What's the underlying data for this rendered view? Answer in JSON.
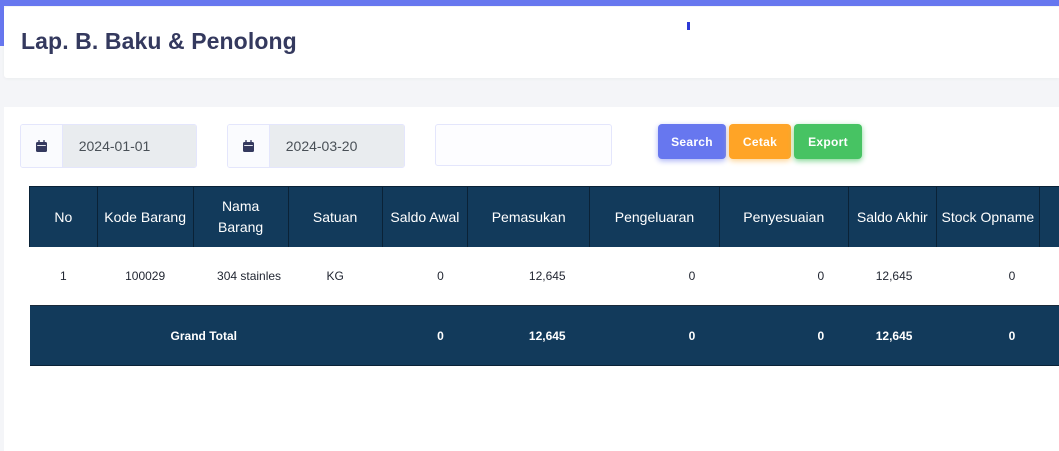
{
  "header": {
    "title": "Lap. B. Baku & Penolong"
  },
  "filters": {
    "start_date": "2024-01-01",
    "end_date": "2024-03-20",
    "search_text": "",
    "calendar_icon": "calendar-icon"
  },
  "buttons": {
    "search": "Search",
    "print": "Cetak",
    "export": "Export"
  },
  "colors": {
    "accent": "#6777ef",
    "print": "#ffa426",
    "export": "#47c363",
    "table_header": "#123a5b"
  },
  "table": {
    "columns": [
      "No",
      "Kode Barang",
      "Nama Barang",
      "Satuan",
      "Saldo Awal",
      "Pemasukan",
      "Pengeluaran",
      "Penyesuaian",
      "Saldo Akhir",
      "Stock Opname"
    ],
    "rows": [
      [
        "1",
        "100029",
        "304 stainles",
        "KG",
        "0",
        "12,645",
        "0",
        "0",
        "12,645",
        "0"
      ]
    ],
    "total": {
      "label": "Grand Total",
      "saldo_awal": "0",
      "pemasukan": "12,645",
      "pengeluaran": "0",
      "penyesuaian": "0",
      "saldo_akhir": "12,645",
      "stock_opname": "0"
    }
  }
}
